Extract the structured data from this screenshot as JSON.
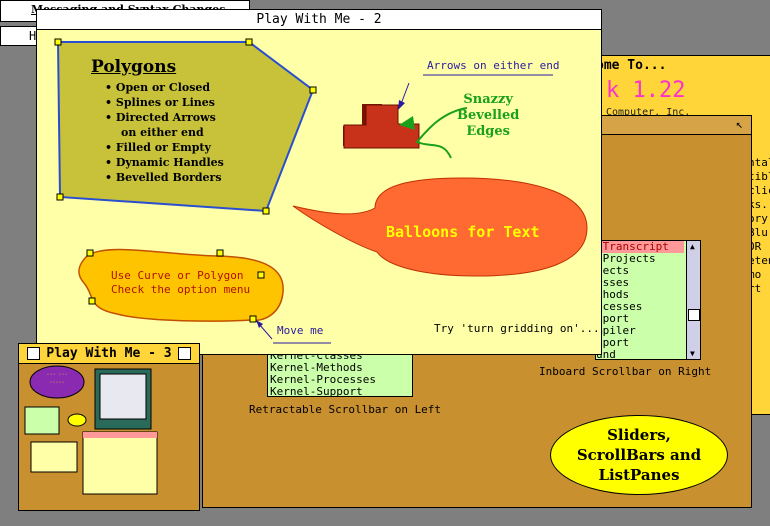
{
  "background_windows": {
    "top_left_title_1": "Messaging and Syntax Changes",
    "top_left_title_2": "H",
    "welcome_title": "ome To...",
    "welcome_version": "k 1.22",
    "welcome_company": "Computer, Inc.",
    "welcome_side_text": [
      "ntal",
      "tibl",
      "",
      "clic",
      "ks.",
      "",
      "ory.",
      "Blu",
      "",
      "OR",
      "",
      "eten",
      "mo",
      "rt"
    ]
  },
  "sliders_window": {
    "left_list_items": [
      "Kernel-Classes",
      "Kernel-Methods",
      "Kernel-Processes",
      "Kernel-Support"
    ],
    "left_caption": "Retractable Scrollbar on Left",
    "right_list_items": [
      "-Transcript",
      "-Projects",
      "jects",
      "asses",
      "thods",
      "ocesses",
      "pport",
      "mpiler",
      "pport",
      "und"
    ],
    "right_caption": "Inboard Scrollbar on Right",
    "badge_text": [
      "Sliders,",
      "ScrollBars and",
      "ListPanes"
    ]
  },
  "main_window": {
    "title": "Play With Me - 2",
    "polygons_heading": "Polygons",
    "polygon_features": [
      "Open or Closed",
      "Splines or Lines",
      "Directed Arrows",
      "on either end",
      "Filled or Empty",
      "Dynamic Handles",
      "Bevelled Borders"
    ],
    "arrows_label": "Arrows on either end",
    "bevel_label": [
      "Snazzy",
      "Bevelled",
      "Edges"
    ],
    "balloon_text": "Balloons for Text",
    "curve_text": [
      "Use Curve or Polygon",
      "Check the option menu"
    ],
    "move_me": "Move me",
    "gridding_hint": "Try 'turn gridding on'..."
  },
  "small_window": {
    "title": "Play With Me - 3"
  },
  "colors": {
    "desktop": "#7f7f7f",
    "main_bg": "#ffffa8",
    "sliders_bg": "#c8902f",
    "welcome_bg": "#ffd53a",
    "polygon_fill": "#c8c23a",
    "balloon": "#ff6a33",
    "curve_fill": "#ffc400",
    "ellipse_fill": "#ffff00",
    "list_bg": "#ccffaa"
  }
}
